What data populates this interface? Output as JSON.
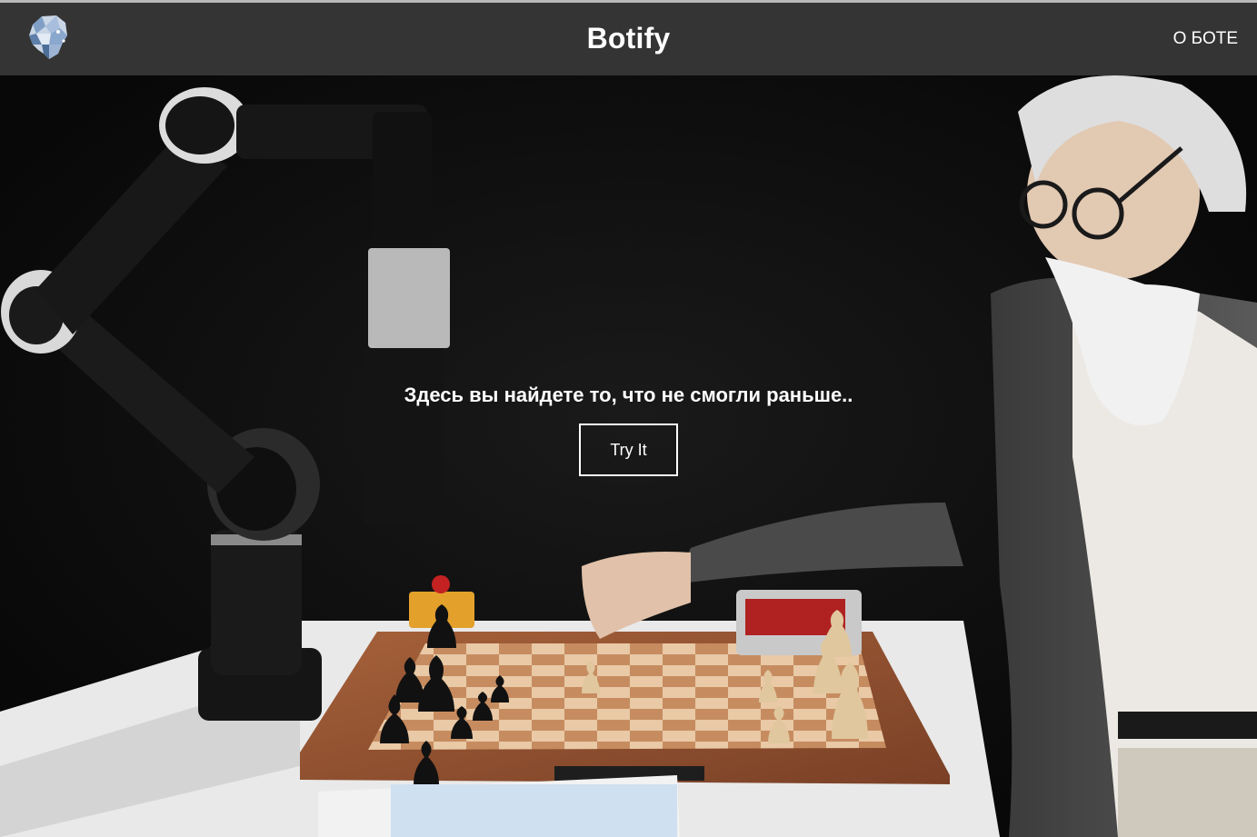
{
  "header": {
    "logo_icon": "robot-head-icon",
    "brand": "Botify",
    "nav_about": "О БОТЕ"
  },
  "hero": {
    "background_image": "robot-arm-playing-chess-with-bearded-man",
    "tagline": "Здесь вы найдете то, что не смогли раньше..",
    "cta_label": "Try It"
  },
  "colors": {
    "navbar": "#343434",
    "text": "#ffffff",
    "hero_bg": "#0e0e0e"
  }
}
